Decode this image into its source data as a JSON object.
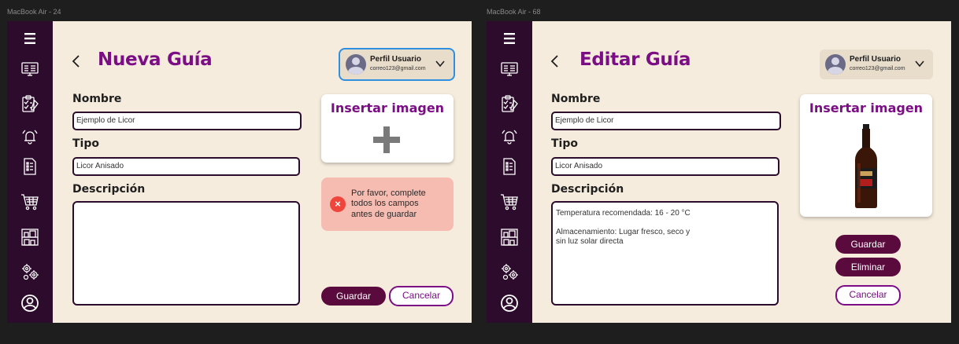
{
  "frames": [
    {
      "label": "MacBook Air - 24",
      "title": "Nueva Guía",
      "profile": {
        "name": "Perfil Usuario",
        "email": "correo123@gmail.com"
      },
      "form": {
        "nombre_label": "Nombre",
        "nombre_value": "Ejemplo de Licor",
        "tipo_label": "Tipo",
        "tipo_value": "Licor Anisado",
        "descripcion_label": "Descripción",
        "descripcion_value": ""
      },
      "image_card": {
        "title": "Insertar imagen"
      },
      "error": "Por favor, complete todos los campos antes de guardar",
      "buttons": {
        "save": "Guardar",
        "cancel": "Cancelar"
      }
    },
    {
      "label": "MacBook Air - 68",
      "title": "Editar Guía",
      "profile": {
        "name": "Perfil Usuario",
        "email": "correo123@gmail.com"
      },
      "form": {
        "nombre_label": "Nombre",
        "nombre_value": "Ejemplo de Licor",
        "tipo_label": "Tipo",
        "tipo_value": "Licor Anisado",
        "descripcion_label": "Descripción",
        "descripcion_value": "Temperatura recomendada: 16 - 20 °C\n\nAlmacenamiento: Lugar fresco, seco y\nsin luz solar directa"
      },
      "image_card": {
        "title": "Insertar imagen"
      },
      "buttons": {
        "save": "Guardar",
        "delete": "Eliminar",
        "cancel": "Cancelar"
      }
    }
  ],
  "sidebar_icons": [
    "menu-icon",
    "dashboard-icon",
    "clipboard-checklist-icon",
    "alarm-bell-icon",
    "document-list-icon",
    "shopping-cart-icon",
    "warehouse-shelf-icon",
    "settings-gears-icon",
    "user-circle-icon"
  ],
  "colors": {
    "sidebar": "#2d0b2c",
    "background": "#f6ecdd",
    "accent": "#7b0e85",
    "primary_button": "#5a0a3d",
    "error_bg": "#f7bcb1",
    "error_icon": "#f0453b",
    "selection": "#2f8fe0"
  }
}
